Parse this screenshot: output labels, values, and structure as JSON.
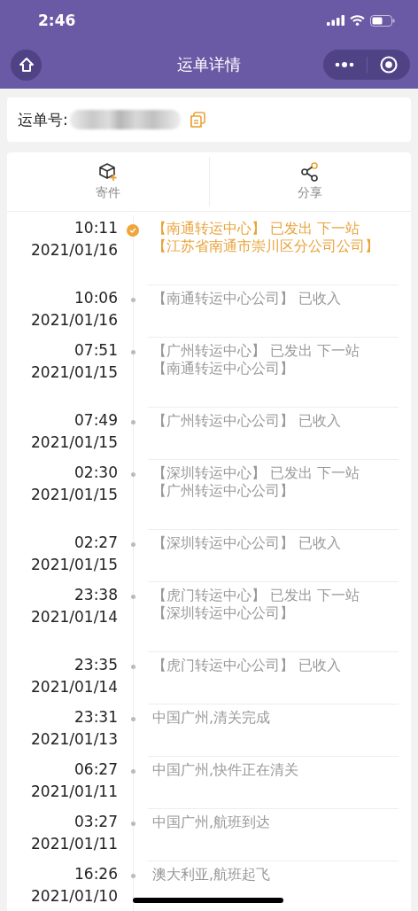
{
  "status_bar": {
    "time": "2:46"
  },
  "nav": {
    "title": "运单详情"
  },
  "waybill": {
    "label": "运单号:"
  },
  "actions": [
    {
      "label": "寄件",
      "kind": "send"
    },
    {
      "label": "分享",
      "kind": "share"
    }
  ],
  "timeline": [
    {
      "time": "10:11",
      "date": "2021/01/16",
      "lines": [
        "【南通转运中心】 已发出 下一站",
        "【江苏省南通市崇川区分公司公司】"
      ],
      "current": true
    },
    {
      "time": "10:06",
      "date": "2021/01/16",
      "lines": [
        "【南通转运中心公司】 已收入"
      ],
      "current": false
    },
    {
      "time": "07:51",
      "date": "2021/01/15",
      "lines": [
        "【广州转运中心】 已发出 下一站",
        "【南通转运中心公司】"
      ],
      "current": false
    },
    {
      "time": "07:49",
      "date": "2021/01/15",
      "lines": [
        "【广州转运中心公司】 已收入"
      ],
      "current": false
    },
    {
      "time": "02:30",
      "date": "2021/01/15",
      "lines": [
        "【深圳转运中心】 已发出 下一站",
        "【广州转运中心公司】"
      ],
      "current": false
    },
    {
      "time": "02:27",
      "date": "2021/01/15",
      "lines": [
        "【深圳转运中心公司】 已收入"
      ],
      "current": false
    },
    {
      "time": "23:38",
      "date": "2021/01/14",
      "lines": [
        "【虎门转运中心】 已发出 下一站",
        "【深圳转运中心公司】"
      ],
      "current": false
    },
    {
      "time": "23:35",
      "date": "2021/01/14",
      "lines": [
        "【虎门转运中心公司】 已收入"
      ],
      "current": false
    },
    {
      "time": "23:31",
      "date": "2021/01/13",
      "lines": [
        "中国广州,清关完成"
      ],
      "current": false
    },
    {
      "time": "06:27",
      "date": "2021/01/11",
      "lines": [
        "中国广州,快件正在清关"
      ],
      "current": false
    },
    {
      "time": "03:27",
      "date": "2021/01/11",
      "lines": [
        "中国广州,航班到达"
      ],
      "current": false
    },
    {
      "time": "16:26",
      "date": "2021/01/10",
      "lines": [
        "澳大利亚,航班起飞"
      ],
      "current": false
    }
  ]
}
